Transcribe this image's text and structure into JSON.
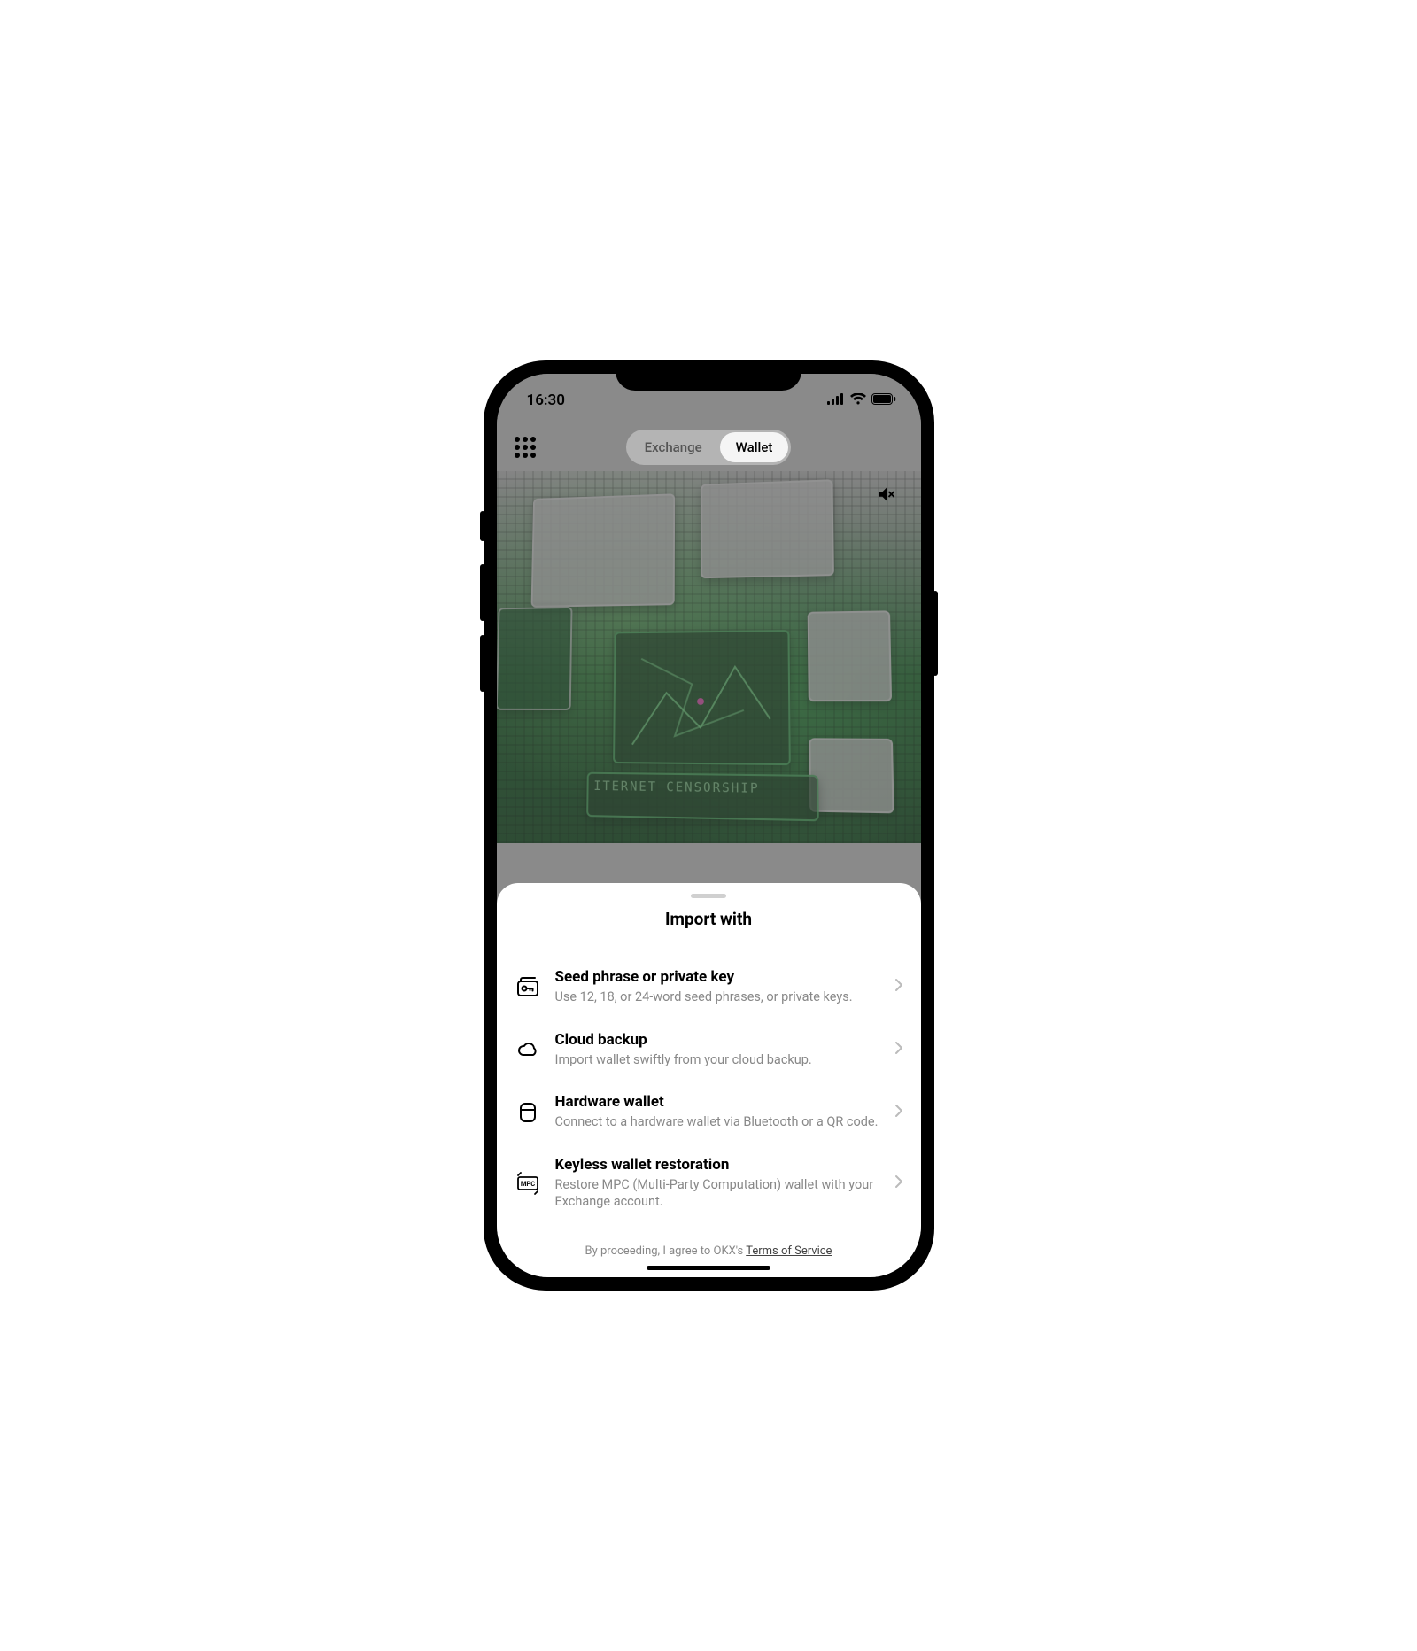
{
  "status": {
    "time": "16:30"
  },
  "header": {
    "tabs": {
      "exchange": "Exchange",
      "wallet": "Wallet"
    }
  },
  "hero": {
    "banner_text": "ITERNET CENSORSHIP"
  },
  "sheet": {
    "title": "Import with",
    "options": [
      {
        "title": "Seed phrase or private key",
        "desc": "Use 12, 18, or 24-word seed phrases, or private keys."
      },
      {
        "title": "Cloud backup",
        "desc": "Import wallet swiftly from your cloud backup."
      },
      {
        "title": "Hardware wallet",
        "desc": "Connect to a hardware wallet via Bluetooth or a QR code."
      },
      {
        "title": "Keyless wallet restoration",
        "desc": "Restore MPC (Multi-Party Computation) wallet with your Exchange account."
      }
    ],
    "footer_prefix": "By proceeding, I agree to OKX's ",
    "footer_link": "Terms of Service",
    "mpc_label": "MPC"
  }
}
